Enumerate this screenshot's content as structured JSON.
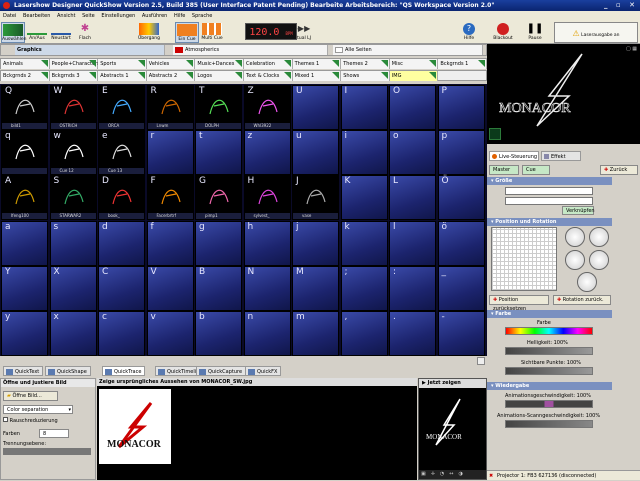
{
  "window": {
    "title": "Lasershow Designer QuickShow  Version 2.5, Build 385  (User Interface Patent Pending)  Bearbeite Arbeitsbereich: \"QS Workspace Version 2.0\"",
    "controls": "_ ▫ ✕"
  },
  "menu": [
    "Datei",
    "Bearbeiten",
    "Ansicht",
    "Seite",
    "Einstellungen",
    "Ausführen",
    "Hilfe",
    "Sprache"
  ],
  "toolbar": {
    "buttons": [
      "Auswählen",
      "An/Aus",
      "Neustart",
      "Flach",
      "Übergang",
      "Ein Cue",
      "Multi Cue",
      "Virtual LJ"
    ],
    "timer": "120.0",
    "timer_unit": "BPM",
    "help": "Hilfe",
    "blackout": "Blackout",
    "pause": "Pause",
    "laser_output": "Laserausgabe an"
  },
  "pages": {
    "graphics": "Graphics",
    "atmospherics": "Atmospherics",
    "all": "Alle Seiten"
  },
  "categories_row1": [
    "Animals",
    "People+Characters",
    "Sports",
    "Vehicles",
    "Music+Dances",
    "Celebration",
    "Themes 1",
    "Themes 2",
    "Misc",
    "Bckgrnds 1"
  ],
  "categories_row2": [
    "Bckgrnds 2",
    "Bckgrnds 3",
    "Abstracts 1",
    "Abstracts 2",
    "Logos",
    "Text & Clocks",
    "Mixed 1",
    "Shows",
    "IMG"
  ],
  "grid": {
    "rows": [
      {
        "keys": [
          "Q",
          "W",
          "E",
          "R",
          "T",
          "Z",
          "U",
          "I",
          "O",
          "P"
        ],
        "labels": [
          "bild1",
          "OSTRICH",
          "ORCA",
          "Lnwm",
          "DOLPH",
          "Whl3922",
          "",
          "",
          "",
          ""
        ]
      },
      {
        "keys": [
          "q",
          "w",
          "e",
          "r",
          "t",
          "z",
          "u",
          "i",
          "o",
          "p"
        ],
        "labels": [
          "",
          "Cue 12",
          "Cue 13",
          "",
          "",
          "",
          "",
          "",
          "",
          ""
        ]
      },
      {
        "keys": [
          "A",
          "S",
          "D",
          "F",
          "G",
          "H",
          "J",
          "K",
          "L",
          "Ö"
        ],
        "labels": [
          "Ifeng100",
          "STARWAR2",
          "book_",
          "Facerbrtrf",
          "pimp1",
          "sylvest_",
          "vase",
          "",
          "",
          ""
        ]
      },
      {
        "keys": [
          "a",
          "s",
          "d",
          "f",
          "g",
          "h",
          "j",
          "k",
          "l",
          "ö"
        ],
        "labels": [
          "",
          "",
          "",
          "",
          "",
          "",
          "",
          "",
          "",
          ""
        ]
      },
      {
        "keys": [
          "Y",
          "X",
          "C",
          "V",
          "B",
          "N",
          "M",
          ";",
          ":",
          "_"
        ],
        "labels": [
          "",
          "",
          "",
          "",
          "",
          "",
          "",
          "",
          "",
          ""
        ]
      },
      {
        "keys": [
          "y",
          "x",
          "c",
          "v",
          "b",
          "n",
          "m",
          ",",
          ".",
          "-"
        ],
        "labels": [
          "",
          "",
          "",
          "",
          "",
          "",
          "",
          "",
          "",
          ""
        ]
      }
    ]
  },
  "tabs": [
    "QuickText",
    "QuickShape",
    "QuickTrace",
    "QuickTimeline",
    "QuickCapture",
    "QuickFX"
  ],
  "trace": {
    "left_title": "Öffne und justiere Bild",
    "open_btn": "Öffne Bild...",
    "mode": "Color separation",
    "noise": "Rauschreduzierung",
    "colors_label": "Farben",
    "colors_value": "8",
    "sep_label": "Trennungsebene:",
    "center_title": "Zeige ursprüngliches Aussehen von MONACOR_SW.jpg",
    "show_now": "Jetzt zeigen",
    "logo_text": "MONACOR"
  },
  "right": {
    "logo": "MONACOR",
    "live_tab": "Live-Steuerung",
    "effect_tab": "Effekt",
    "master": "Master",
    "cue": "Cue",
    "back": "Zurück",
    "size": "Größe",
    "link": "Verknüpfen",
    "pos_rot": "Position und Rotation",
    "pos_reset": "Position zurücksetzen",
    "rot_reset": "Rotation zurück.",
    "color": "Farbe",
    "color_label": "Farbe",
    "brightness": "Helligkeit: 100%",
    "visible_points": "Sichtbare Punkte: 100%",
    "playback": "Wiedergabe",
    "anim_speed": "Animationsgeschwindigkeit: 100%",
    "anim_scan": "Animations-Scanngeschwindigkeit: 100%"
  },
  "status": "Projector 1: FB3 627136 (disconnected)"
}
